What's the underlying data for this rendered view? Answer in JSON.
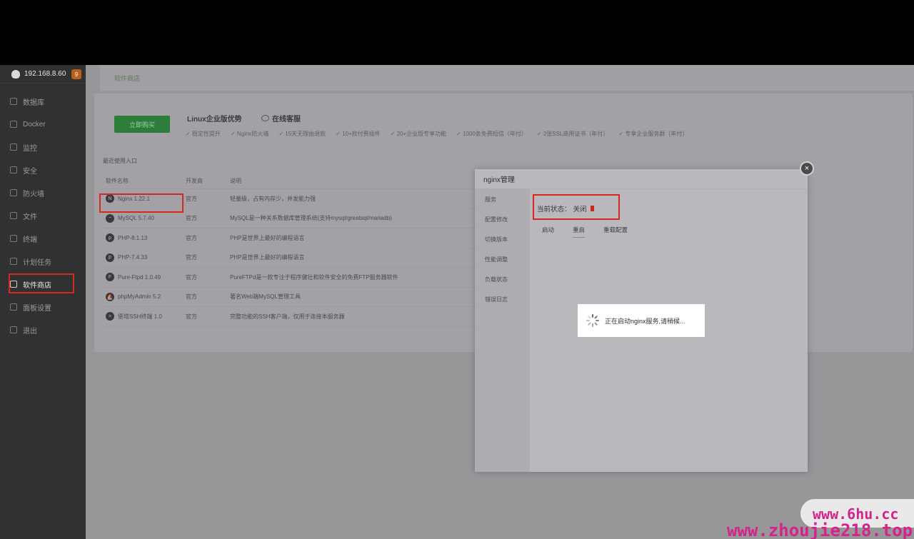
{
  "server": {
    "ip": "192.168.8.60",
    "badge": "9"
  },
  "sidebar": {
    "items": [
      {
        "label": "数据库",
        "icon": "database-icon"
      },
      {
        "label": "Docker",
        "icon": "docker-icon"
      },
      {
        "label": "监控",
        "icon": "monitor-icon"
      },
      {
        "label": "安全",
        "icon": "shield-icon"
      },
      {
        "label": "防火墙",
        "icon": "firewall-icon"
      },
      {
        "label": "文件",
        "icon": "folder-icon"
      },
      {
        "label": "终端",
        "icon": "terminal-icon"
      },
      {
        "label": "计划任务",
        "icon": "clock-icon"
      },
      {
        "label": "软件商店",
        "icon": "grid-icon"
      },
      {
        "label": "面板设置",
        "icon": "gear-icon"
      },
      {
        "label": "退出",
        "icon": "logout-icon"
      }
    ]
  },
  "breadcrumb": "软件商店",
  "promo": {
    "buy_button": "立即购买",
    "title": "Linux企业版优势",
    "online_service": "在线客服",
    "features": [
      "✓ 稳定性提升",
      "✓ Nginx防火墙",
      "✓ 15天无理由退款",
      "✓ 10+款付费插件",
      "✓ 20+企业版专享功能",
      "✓ 1000条免费短信（年付）",
      "✓ 2张SSL商用证书（年付）",
      "✓ 专享企业服务群（年付）"
    ]
  },
  "recent": {
    "label": "最近使用入口",
    "columns": [
      "软件名称",
      "开发商",
      "说明"
    ],
    "rows": [
      {
        "name": "Nginx 1.22.1",
        "dev": "官方",
        "desc": "轻量级，占有内存少，并发能力强",
        "icon": "nginx-icon"
      },
      {
        "name": "MySQL 5.7.40",
        "dev": "官方",
        "desc": "MySQL是一种关系数据库管理系统(支持mysql/greatsql/mariadb)",
        "icon": "mysql-icon"
      },
      {
        "name": "PHP-8.1.13",
        "dev": "官方",
        "desc": "PHP是世界上最好的编程语言",
        "icon": "php-icon"
      },
      {
        "name": "PHP-7.4.33",
        "dev": "官方",
        "desc": "PHP是世界上最好的编程语言",
        "icon": "php-icon"
      },
      {
        "name": "Pure-Ftpd 1.0.49",
        "dev": "官方",
        "desc": "PureFTPd是一款专注于程序健壮和软件安全的免费FTP服务器软件",
        "icon": "ftp-icon"
      },
      {
        "name": "phpMyAdmin 5.2",
        "dev": "官方",
        "desc": "著名Web端MySQL管理工具",
        "icon": "phpmyadmin-icon"
      },
      {
        "name": "堡塔SSH终端 1.0",
        "dev": "官方",
        "desc": "完整功能的SSH客户端，仅用于连接本服务器",
        "icon": "ssh-icon"
      }
    ]
  },
  "modal": {
    "title": "nginx管理",
    "tabs": [
      "服务",
      "配置修改",
      "切换版本",
      "性能调整",
      "负载状态",
      "错误日志"
    ],
    "status_label": "当前状态：",
    "status_value": "关闭",
    "actions": [
      "启动",
      "重启",
      "重载配置"
    ],
    "close_symbol": "×"
  },
  "toast": {
    "text": "正在启动nginx服务,请稍候..."
  },
  "watermark": {
    "line1": "www.6hu.cc",
    "line2": "www.zhoujie218.top"
  },
  "colors": {
    "accent_green": "#2c7d3a",
    "highlight_red": "#d8271c",
    "watermark": "#d4238a"
  }
}
